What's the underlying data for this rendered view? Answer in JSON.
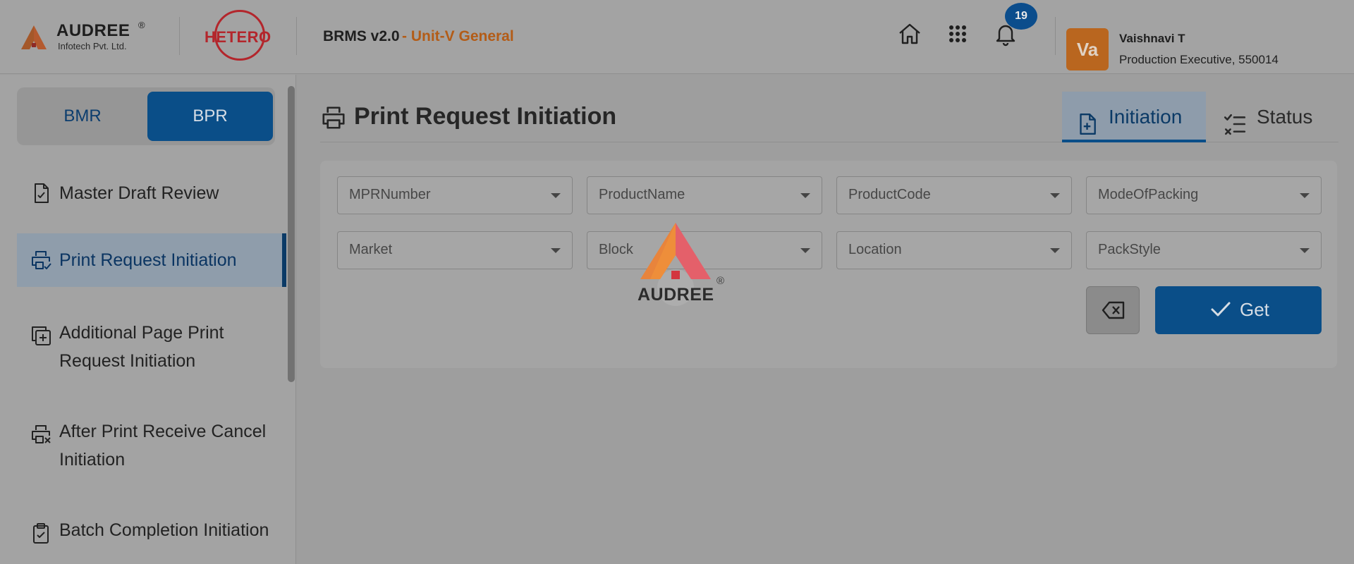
{
  "header": {
    "brand": {
      "name": "AUDREE",
      "reg": "®",
      "sub": "Infotech Pvt. Ltd."
    },
    "client_logo": "HETERO",
    "app_title": "BRMS v2.0",
    "unit": "- Unit-V General",
    "icons": [
      "home-icon",
      "apps-grid-icon",
      "bell-icon"
    ],
    "notification_count": "19",
    "user": {
      "initials": "Va",
      "name": "Vaishnavi T",
      "role": "Production Executive, 550014"
    }
  },
  "sidebar": {
    "toggle": {
      "bmr": "BMR",
      "bpr": "BPR",
      "selected": "BPR"
    },
    "items": [
      {
        "label": "Master Draft Review",
        "icon": "file-check-icon"
      },
      {
        "label": "Print Request Initiation",
        "icon": "printer-check-icon",
        "active": true
      },
      {
        "label": "Additional Page Print Request Initiation",
        "icon": "copy-plus-icon"
      },
      {
        "label": "After Print Receive Cancel Initiation",
        "icon": "printer-x-icon"
      },
      {
        "label": "Batch Completion Initiation",
        "icon": "clipboard-check-icon"
      }
    ]
  },
  "main": {
    "title": "Print Request Initiation",
    "tabs": [
      {
        "label": "Initiation",
        "icon": "file-plus-icon",
        "active": true
      },
      {
        "label": "Status",
        "icon": "list-check-icon"
      }
    ],
    "filters": [
      {
        "placeholder": "MPRNumber"
      },
      {
        "placeholder": "ProductName"
      },
      {
        "placeholder": "ProductCode"
      },
      {
        "placeholder": "ModeOfPacking"
      },
      {
        "placeholder": "Market"
      },
      {
        "placeholder": "Block"
      },
      {
        "placeholder": "Location"
      },
      {
        "placeholder": "PackStyle"
      }
    ],
    "clear_button_icon": "backspace-icon",
    "get_button": "Get",
    "loader": {
      "text": "AUDREE",
      "reg": "®"
    }
  },
  "colors": {
    "overlay_bg": "#9e9e9e",
    "primary": "#0a4e88",
    "unit_orange": "#b35c17",
    "avatar": "#b9661f",
    "hetero_red": "#b3262c"
  }
}
